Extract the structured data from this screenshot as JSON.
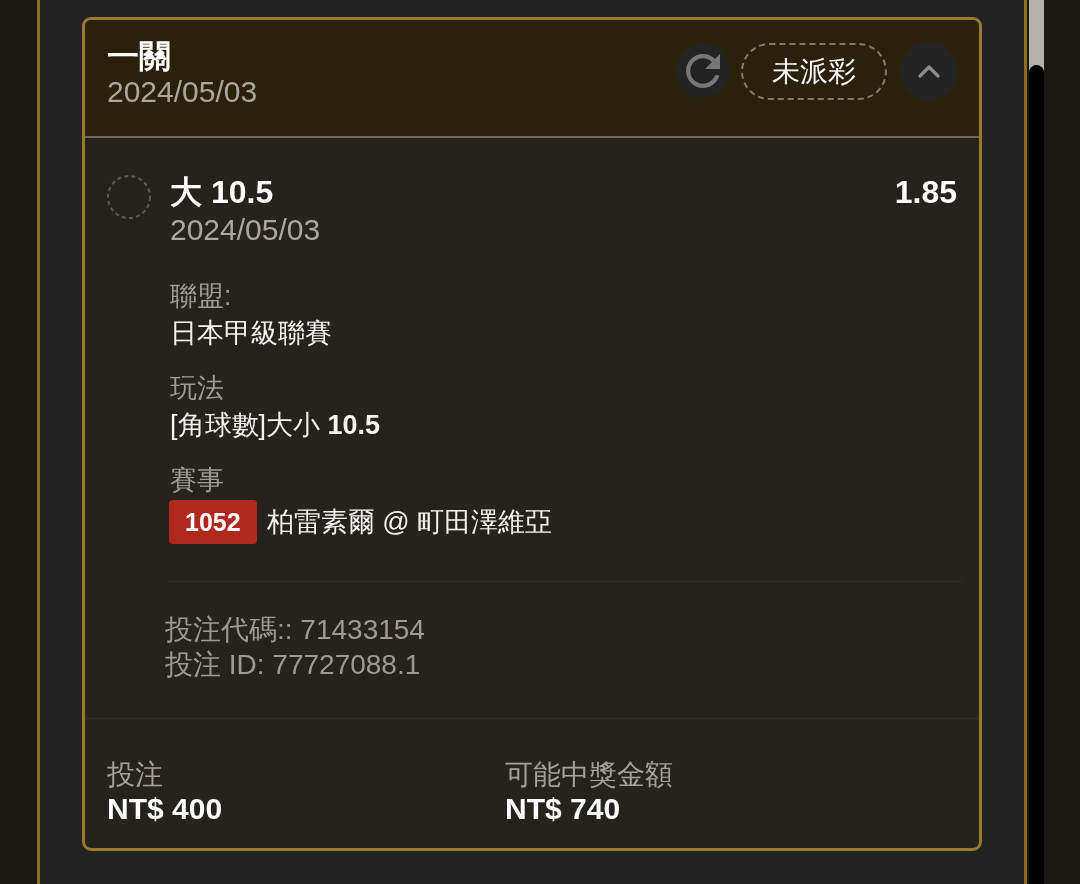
{
  "bet_card": {
    "header": {
      "title": "一關",
      "date": "2024/05/03",
      "status": "未派彩",
      "expanded": true
    },
    "selection": {
      "name": "大 10.5",
      "odds": "1.85",
      "date": "2024/05/03"
    },
    "details": [
      {
        "label": "聯盟:",
        "value": "日本甲級聯賽"
      },
      {
        "label": "玩法",
        "value": "[角球數]大小 **10.5**"
      },
      {
        "label": "賽事",
        "badge": "1052",
        "value": "柏雷素爾 @ 町田澤維亞"
      }
    ],
    "references": [
      "投注代碼:: 71433154",
      "投注 ID: 77727088.1"
    ],
    "totals": [
      {
        "label": "投注",
        "value": "NT$ 400"
      },
      {
        "label": "可能中獎金額",
        "value": "NT$ 740"
      }
    ]
  }
}
